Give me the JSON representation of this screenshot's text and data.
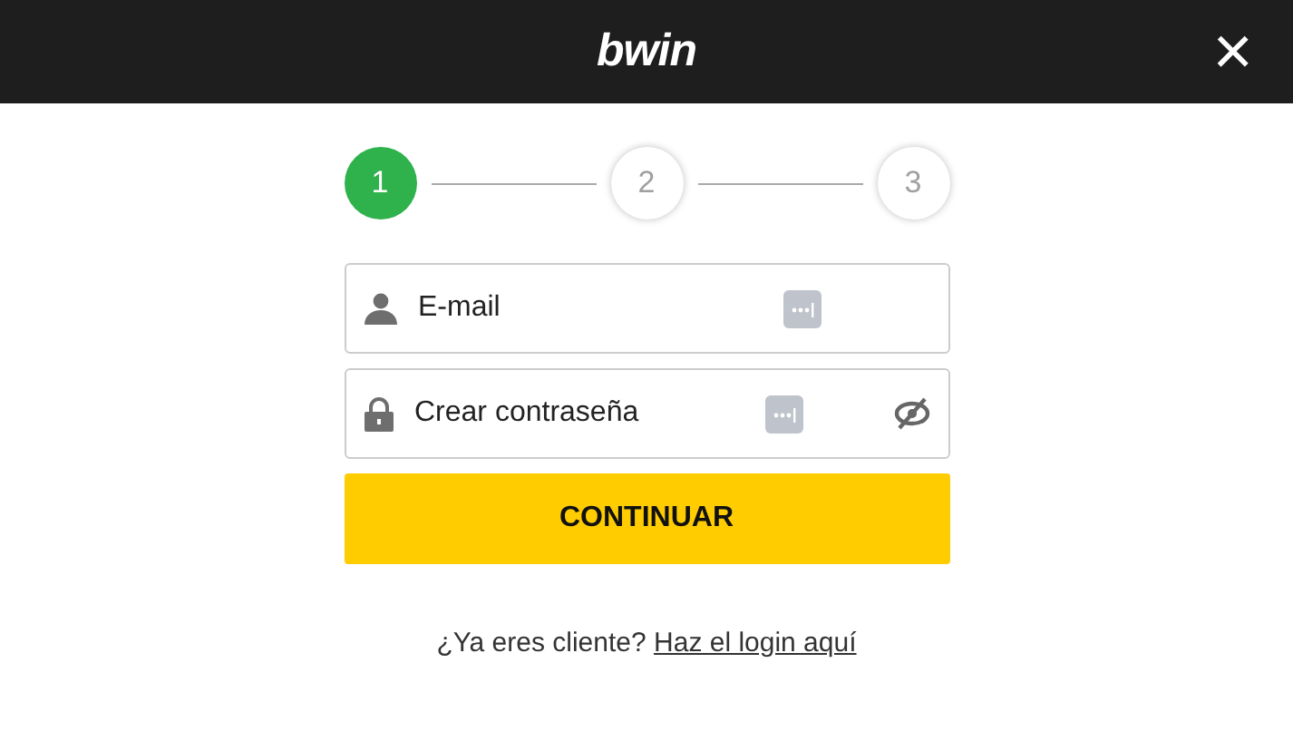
{
  "header": {
    "logo": "bwin",
    "close": "×"
  },
  "steps": [
    {
      "label": "1",
      "selected": true
    },
    {
      "label": "2",
      "selected": false
    },
    {
      "label": "3",
      "selected": false
    }
  ],
  "fields": [
    {
      "kind": "email",
      "placeholder": "E-mail",
      "reveal": false
    },
    {
      "kind": "password",
      "placeholder": "Crear contraseña",
      "reveal": true
    }
  ],
  "submit": "CONTINUAR",
  "footer": {
    "text": "¿Ya eres cliente?",
    "link": "Haz el login aquí"
  }
}
